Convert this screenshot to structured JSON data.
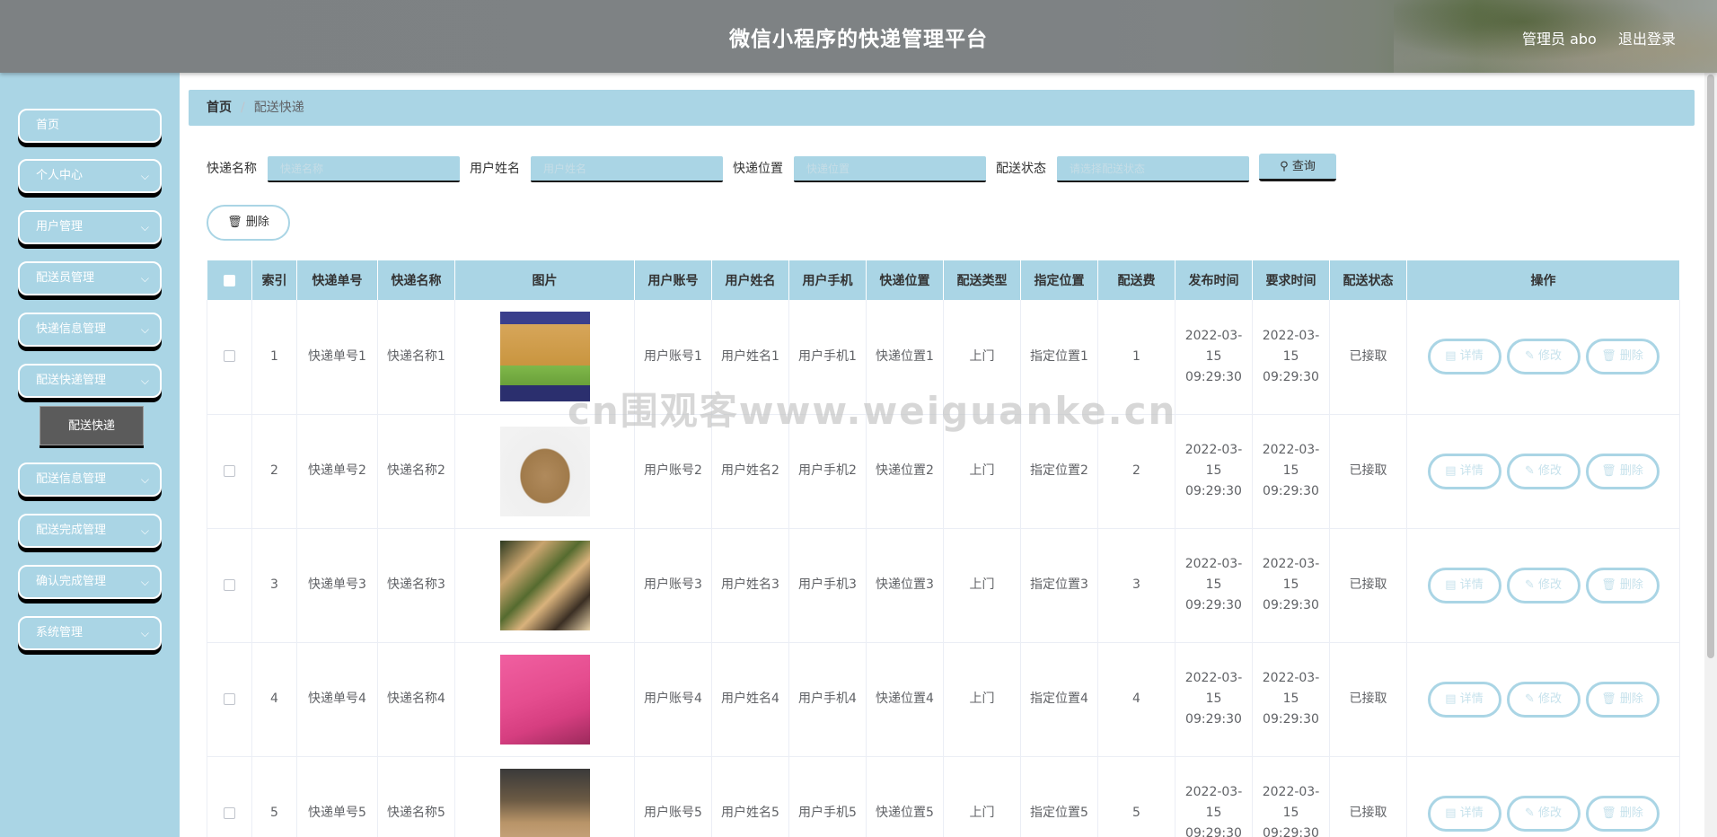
{
  "header": {
    "title": "微信小程序的快递管理平台",
    "user": "管理员 abo",
    "logout": "退出登录"
  },
  "sidebar": {
    "items": [
      {
        "label": "首页",
        "chevron": false
      },
      {
        "label": "个人中心",
        "chevron": true
      },
      {
        "label": "用户管理",
        "chevron": true
      },
      {
        "label": "配送员管理",
        "chevron": true
      },
      {
        "label": "快递信息管理",
        "chevron": true
      },
      {
        "label": "配送快递管理",
        "chevron": true
      },
      {
        "label": "配送信息管理",
        "chevron": true
      },
      {
        "label": "配送完成管理",
        "chevron": true
      },
      {
        "label": "确认完成管理",
        "chevron": true
      },
      {
        "label": "系统管理",
        "chevron": true
      }
    ],
    "active_sub": "配送快递"
  },
  "breadcrumb": {
    "home": "首页",
    "separator": "/",
    "current": "配送快递"
  },
  "filters": [
    {
      "label": "快递名称",
      "placeholder": "快递名称"
    },
    {
      "label": "用户姓名",
      "placeholder": "用户姓名"
    },
    {
      "label": "快递位置",
      "placeholder": "快递位置"
    },
    {
      "label": "配送状态",
      "placeholder": "请选择配送状态"
    }
  ],
  "search_button": "查询",
  "delete_button": "删除",
  "table": {
    "columns": [
      "索引",
      "快递单号",
      "快递名称",
      "图片",
      "用户账号",
      "用户姓名",
      "用户手机",
      "快递位置",
      "配送类型",
      "指定位置",
      "配送费",
      "发布时间",
      "要求时间",
      "配送状态",
      "操作"
    ],
    "rows": [
      {
        "index": "1",
        "tracking": "快递单号1",
        "name": "快递名称1",
        "account": "用户账号1",
        "username": "用户姓名1",
        "phone": "用户手机1",
        "location": "快递位置1",
        "type": "上门",
        "target": "指定位置1",
        "fee": "1",
        "publish": "2022-03-15 09:29:30",
        "required": "2022-03-15 09:29:30",
        "status": "已接取"
      },
      {
        "index": "2",
        "tracking": "快递单号2",
        "name": "快递名称2",
        "account": "用户账号2",
        "username": "用户姓名2",
        "phone": "用户手机2",
        "location": "快递位置2",
        "type": "上门",
        "target": "指定位置2",
        "fee": "2",
        "publish": "2022-03-15 09:29:30",
        "required": "2022-03-15 09:29:30",
        "status": "已接取"
      },
      {
        "index": "3",
        "tracking": "快递单号3",
        "name": "快递名称3",
        "account": "用户账号3",
        "username": "用户姓名3",
        "phone": "用户手机3",
        "location": "快递位置3",
        "type": "上门",
        "target": "指定位置3",
        "fee": "3",
        "publish": "2022-03-15 09:29:30",
        "required": "2022-03-15 09:29:30",
        "status": "已接取"
      },
      {
        "index": "4",
        "tracking": "快递单号4",
        "name": "快递名称4",
        "account": "用户账号4",
        "username": "用户姓名4",
        "phone": "用户手机4",
        "location": "快递位置4",
        "type": "上门",
        "target": "指定位置4",
        "fee": "4",
        "publish": "2022-03-15 09:29:30",
        "required": "2022-03-15 09:29:30",
        "status": "已接取"
      },
      {
        "index": "5",
        "tracking": "快递单号5",
        "name": "快递名称5",
        "account": "用户账号5",
        "username": "用户姓名5",
        "phone": "用户手机5",
        "location": "快递位置5",
        "type": "上门",
        "target": "指定位置5",
        "fee": "5",
        "publish": "2022-03-15 09:29:30",
        "required": "2022-03-15 09:29:30",
        "status": "已接取"
      }
    ],
    "actions": {
      "detail": "详情",
      "edit": "修改",
      "delete": "删除"
    }
  },
  "watermark": "cn围观客www.weiguanke.cn",
  "colors": {
    "accent": "#aad5e5",
    "header": "#7e8284",
    "submenu_active": "#5b5b5b"
  }
}
